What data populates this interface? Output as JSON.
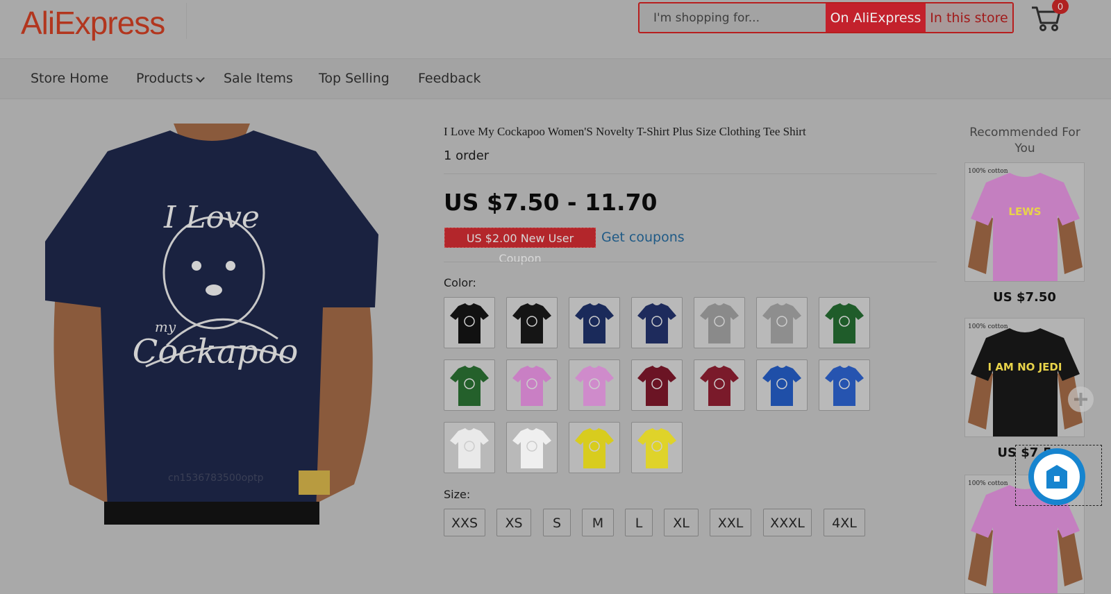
{
  "header": {
    "logo": "AliExpress",
    "search": {
      "placeholder": "I'm shopping for...",
      "on_aliexpress": "On AliExpress",
      "in_this_store": "In this store"
    },
    "cart_count": "0"
  },
  "nav": {
    "items": [
      "Store Home",
      "Products",
      "Sale Items",
      "Top Selling",
      "Feedback"
    ]
  },
  "product": {
    "title": "I Love My Cockapoo Women'S Novelty T-Shirt Plus Size Clothing Tee Shirt",
    "orders": "1 order",
    "price": "US $7.50 - 11.70",
    "coupon": "US $2.00 New User Coupon",
    "get_coupons": "Get coupons",
    "color_label": "Color:",
    "colors": [
      "#111111",
      "#151515",
      "#1a2a5a",
      "#1e2b5c",
      "#8a8a8a",
      "#8e8e8e",
      "#1f5c2a",
      "#24602b",
      "#c97fc4",
      "#cf8bcb",
      "#6b1424",
      "#7a1a2a",
      "#1f4fa8",
      "#2654b0",
      "#e9e9e9",
      "#efefef",
      "#d8cc1e",
      "#dfd32a"
    ],
    "size_label": "Size:",
    "sizes": [
      "XXS",
      "XS",
      "S",
      "M",
      "L",
      "XL",
      "XXL",
      "XXXL",
      "4XL"
    ],
    "main_image_text": {
      "line1": "I Love",
      "line2": "my",
      "line3": "Cockapoo"
    },
    "watermark": "cn1536783500optp"
  },
  "recommended": {
    "title": "Recommended For You",
    "items": [
      {
        "price": "US $7.50",
        "shirt_color": "#c47fc0",
        "print": "LEWS",
        "tag": "100% cotton"
      },
      {
        "price": "US $7.5",
        "shirt_color": "#151515",
        "print": "I AM NO JEDI",
        "tag": "100% cotton"
      },
      {
        "price": "",
        "shirt_color": "#c47fc0",
        "print": "",
        "tag": "100% cotton"
      }
    ]
  }
}
